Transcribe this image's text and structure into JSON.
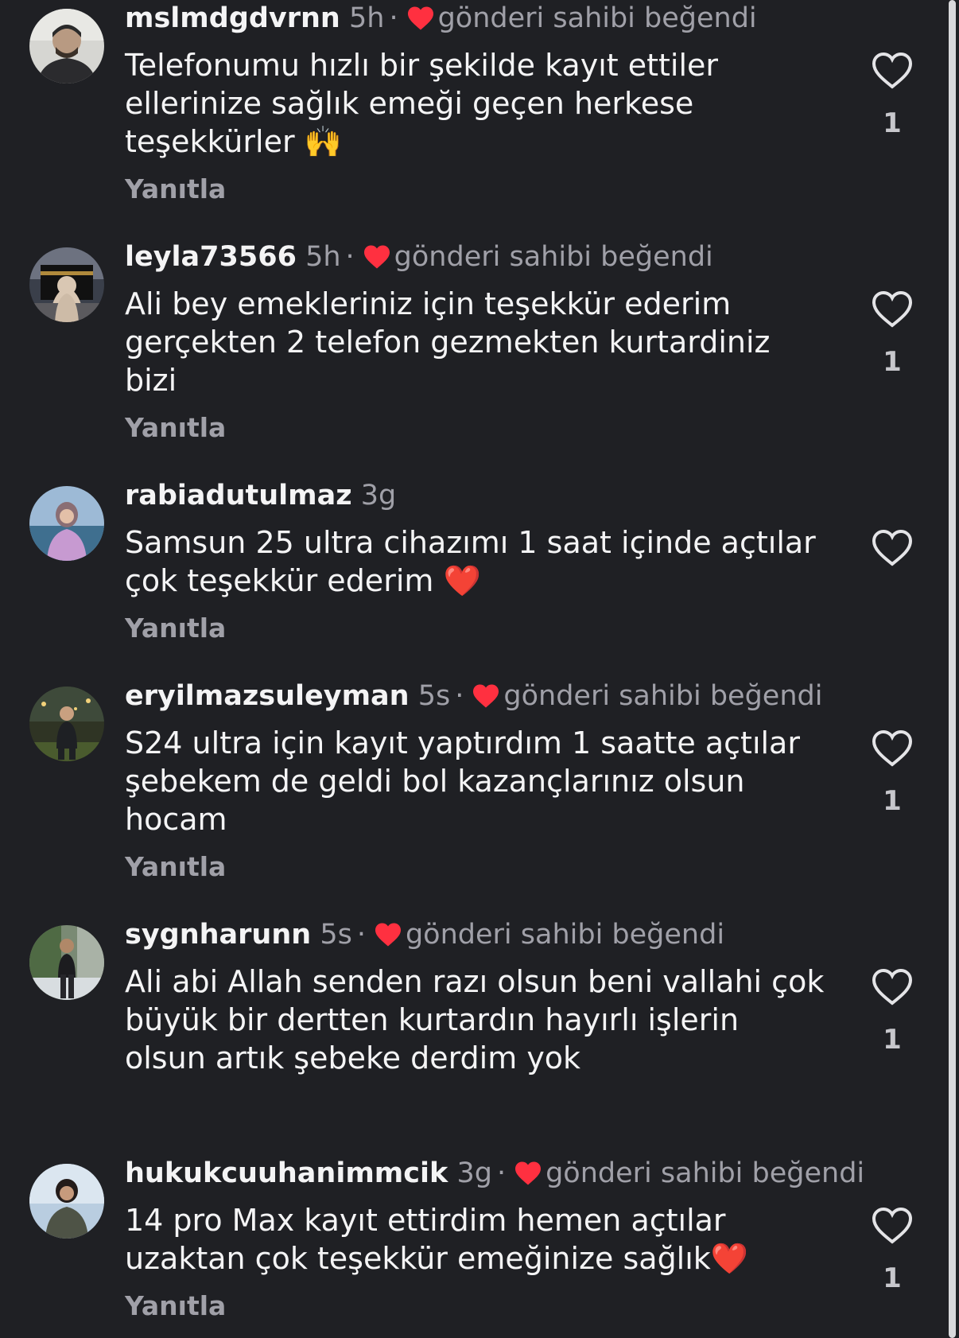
{
  "comments": [
    {
      "username": "mslmdgdvrnn",
      "time": "5h",
      "liked_by_author": true,
      "liked_text": "gönderi sahibi beğendi",
      "text": "Telefonumu hızlı bir şekilde kayıt ettiler ellerinize sağlık emeği geçen herkese teşekkürler 🙌",
      "reply": "Yanıtla",
      "like_count": "1",
      "avatar_icon": "profile-photo-man"
    },
    {
      "username": "leyla73566",
      "time": "5h",
      "liked_by_author": true,
      "liked_text": "gönderi sahibi beğendi",
      "text": "Ali bey emekleriniz için teşekkür ederim gerçekten 2 telefon gezmekten kurtardiniz bizi",
      "reply": "Yanıtla",
      "like_count": "1",
      "avatar_icon": "profile-photo-kaaba"
    },
    {
      "username": "rabiadutulmaz",
      "time": "3g",
      "liked_by_author": false,
      "liked_text": "",
      "text": "Samsun 25 ultra cihazımı 1 saat içinde açtılar çok teşekkür ederim ❤️",
      "reply": "Yanıtla",
      "like_count": "",
      "avatar_icon": "profile-photo-woman-sea"
    },
    {
      "username": "eryilmazsuleyman",
      "time": "5s",
      "liked_by_author": true,
      "liked_text": "gönderi sahibi beğendi",
      "text": "S24 ultra için kayıt yaptırdım 1 saatte açtılar şebekem de geldi bol kazançlarınız olsun hocam",
      "reply": "Yanıtla",
      "like_count": "1",
      "avatar_icon": "profile-photo-man-sitting"
    },
    {
      "username": "sygnharunn",
      "time": "5s",
      "liked_by_author": true,
      "liked_text": "gönderi sahibi beğendi",
      "text": "Ali abi Allah senden razı olsun beni vallahi çok büyük bir dertten kurtardın hayırlı işlerin olsun artık şebeke derdim yok",
      "reply": "",
      "like_count": "1",
      "avatar_icon": "profile-photo-man-standing"
    },
    {
      "username": "hukukcuuhanimmcik",
      "time": "3g",
      "liked_by_author": true,
      "liked_text": "gönderi sahibi beğendi",
      "text": "14 pro Max kayıt ettirdim hemen açtılar uzaktan çok teşekkür emeğinize sağlık❤️",
      "reply": "Yanıtla",
      "like_count": "1",
      "avatar_icon": "profile-photo-woman"
    }
  ],
  "colors": {
    "background": "#1f2024",
    "text": "#f4f4f5",
    "muted": "#a0a0a8",
    "heart_red": "#ff3040",
    "icon": "#e4e4e7"
  }
}
